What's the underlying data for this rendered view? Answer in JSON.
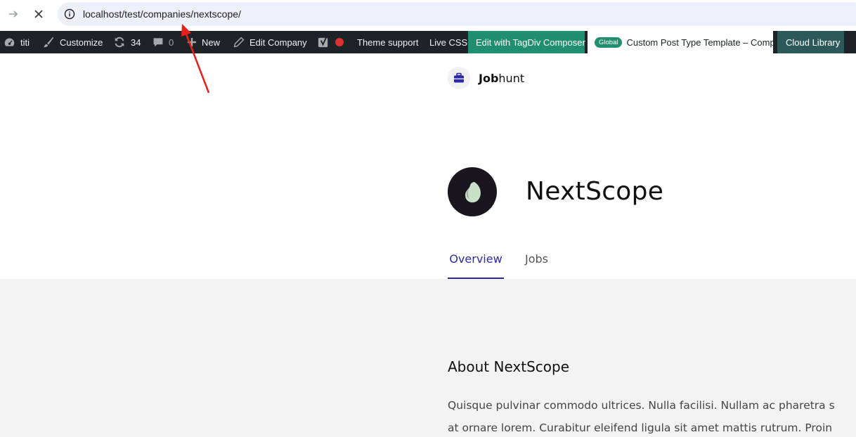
{
  "browser": {
    "url": "localhost/test/companies/nextscope/"
  },
  "admin_bar": {
    "site_name": "titi",
    "customize": "Customize",
    "updates_count": "34",
    "comments_count": "0",
    "new": "New",
    "edit_company": "Edit Company",
    "theme_support": "Theme support",
    "live_css": "Live CSS",
    "tagdiv": "Edit with TagDiv Composer",
    "global_badge": "Global",
    "template": "Custom Post Type Template – Comp...",
    "cloud_library": "Cloud Library"
  },
  "site": {
    "name_bold": "Job",
    "name_rest": "hunt"
  },
  "company": {
    "name": "NextScope"
  },
  "tabs": {
    "overview": "Overview",
    "jobs": "Jobs"
  },
  "about": {
    "title": "About NextScope",
    "line1": "Quisque pulvinar commodo ultrices. Nulla facilisi. Nullam ac pharetra s",
    "line2": "at ornare lorem. Curabitur eleifend ligula sit amet mattis rutrum. Proin"
  },
  "colors": {
    "accent": "#2a2aa8",
    "admin_bar": "#1d2327",
    "tagdiv_green": "#1f8f6e",
    "annotation_arrow": "#e8201c"
  }
}
